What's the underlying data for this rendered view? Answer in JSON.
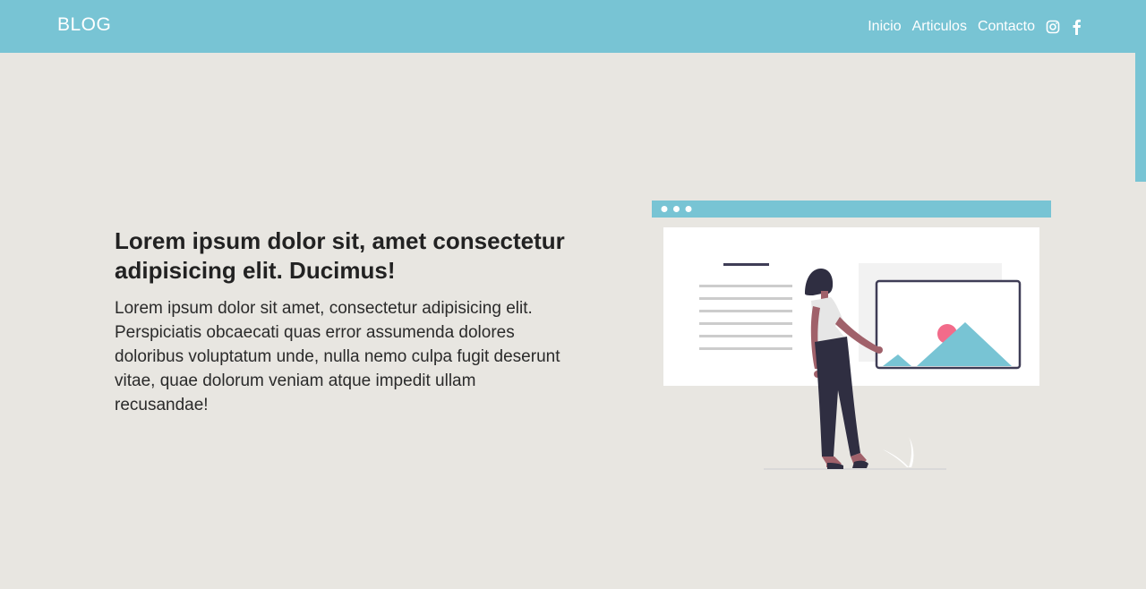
{
  "navbar": {
    "brand": "BLOG",
    "links": [
      "Inicio",
      "Articulos",
      "Contacto"
    ],
    "icons": [
      "instagram-icon",
      "facebook-icon"
    ],
    "background": "#78c4d4"
  },
  "hero": {
    "title": "Lorem ipsum dolor sit, amet consectetur adipisicing elit. Ducimus!",
    "body": "Lorem ipsum dolor sit amet, consectetur adipisicing elit. Perspiciatis obcaecati quas error assumenda dolores doloribus voluptatum unde, nulla nemo culpa fugit deserunt vitae, quae dolorum veniam atque impedit ullam recusandae!"
  },
  "colors": {
    "accent": "#78c4d4",
    "page_background": "#e8e6e1",
    "text": "#222222",
    "illustration_dark": "#2f2e41",
    "illustration_pink": "#f26b8a"
  }
}
